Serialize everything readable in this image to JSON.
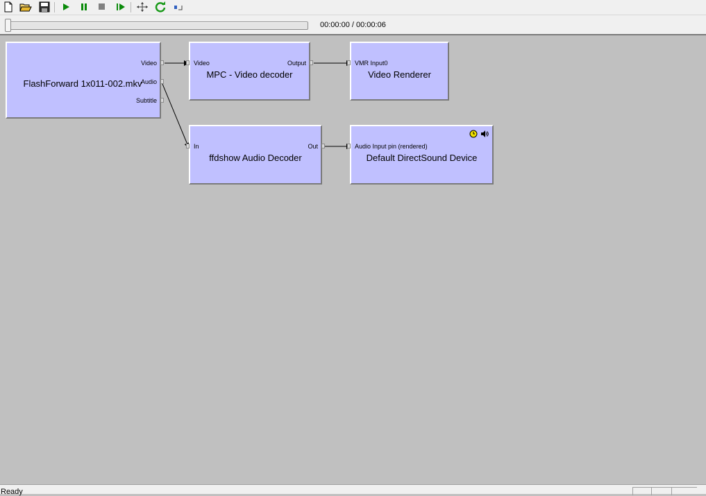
{
  "toolbar": {
    "buttons": [
      {
        "name": "new-file"
      },
      {
        "name": "open-file"
      },
      {
        "name": "save-file"
      },
      {
        "name": "play"
      },
      {
        "name": "pause"
      },
      {
        "name": "stop"
      },
      {
        "name": "step-frame"
      },
      {
        "name": "seek"
      },
      {
        "name": "refresh"
      },
      {
        "name": "resize"
      }
    ],
    "colors": {
      "play": "#0a8a0a",
      "stop": "#808080"
    }
  },
  "seek": {
    "position_fraction": 0.0,
    "time": "00:00:00 / 00:00:06"
  },
  "graph": {
    "filters": {
      "source": {
        "name": "FlashForward 1x011-002.mkv",
        "pins": {
          "video": "Video",
          "audio": "Audio",
          "subtitle": "Subtitle"
        }
      },
      "video_decoder": {
        "name": "MPC - Video decoder",
        "pins": {
          "in": "Video",
          "out": "Output"
        }
      },
      "video_renderer": {
        "name": "Video Renderer",
        "pins": {
          "in": "VMR Input0"
        }
      },
      "audio_decoder": {
        "name": "ffdshow Audio Decoder",
        "pins": {
          "in": "In",
          "out": "Out"
        }
      },
      "audio_renderer": {
        "name": "Default DirectSound Device",
        "pins": {
          "in": "Audio Input pin (rendered)"
        },
        "icons": [
          "clock-icon",
          "speaker-icon"
        ]
      }
    },
    "colors": {
      "filter_fill": "#c0c0ff",
      "background": "#c0c0c0"
    }
  },
  "status": {
    "text": "Ready"
  }
}
